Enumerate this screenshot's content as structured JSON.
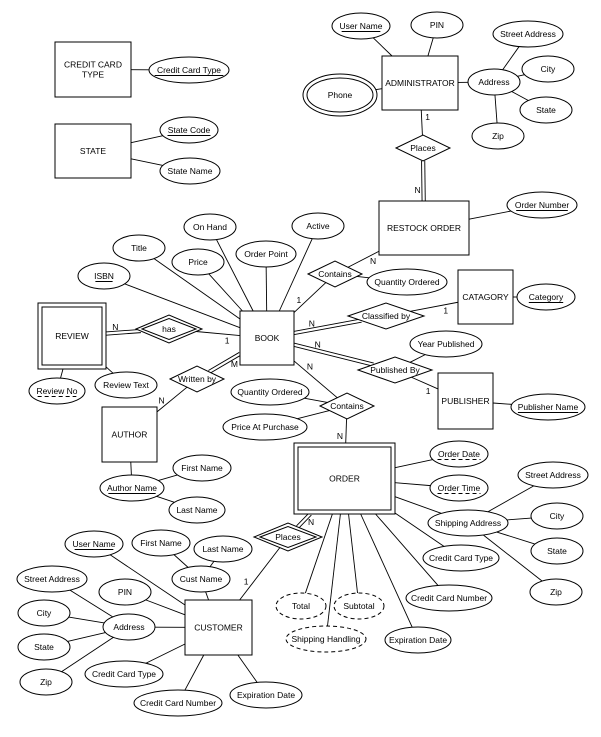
{
  "diagram": {
    "type": "entity-relationship",
    "entities": [
      {
        "id": "credit_card_type",
        "label": [
          "CREDIT CARD",
          "TYPE"
        ],
        "weak": false
      },
      {
        "id": "state",
        "label": [
          "STATE"
        ],
        "weak": false
      },
      {
        "id": "administrator",
        "label": [
          "ADMINISTRATOR"
        ],
        "weak": false
      },
      {
        "id": "restock_order",
        "label": [
          "RESTOCK ORDER"
        ],
        "weak": false
      },
      {
        "id": "catagory",
        "label": [
          "CATAGORY"
        ],
        "weak": false
      },
      {
        "id": "review",
        "label": [
          "REVIEW"
        ],
        "weak": true
      },
      {
        "id": "book",
        "label": [
          "BOOK"
        ],
        "weak": false
      },
      {
        "id": "publisher",
        "label": [
          "PUBLISHER"
        ],
        "weak": false
      },
      {
        "id": "author",
        "label": [
          "AUTHOR"
        ],
        "weak": false
      },
      {
        "id": "order",
        "label": [
          "ORDER"
        ],
        "weak": true
      },
      {
        "id": "customer",
        "label": [
          "CUSTOMER"
        ],
        "weak": false
      }
    ],
    "relationships": [
      {
        "id": "places_admin",
        "label": "Places",
        "identifying": false
      },
      {
        "id": "contains_restock",
        "label": "Contains",
        "identifying": false
      },
      {
        "id": "classified_by",
        "label": "Classified by",
        "identifying": false
      },
      {
        "id": "has",
        "label": "has",
        "identifying": true
      },
      {
        "id": "published_by",
        "label": "Published By",
        "identifying": false
      },
      {
        "id": "written_by",
        "label": "Written by",
        "identifying": false
      },
      {
        "id": "contains_order",
        "label": "Contains",
        "identifying": false
      },
      {
        "id": "places_customer",
        "label": "Places",
        "identifying": true
      }
    ],
    "attributes": [
      {
        "id": "cct_type",
        "label": "Credit Card Type",
        "key": "primary"
      },
      {
        "id": "st_code",
        "label": "State Code",
        "key": "primary"
      },
      {
        "id": "st_name",
        "label": "State Name",
        "key": "none"
      },
      {
        "id": "ad_user",
        "label": "User Name",
        "key": "primary"
      },
      {
        "id": "ad_pin",
        "label": "PIN",
        "key": "none"
      },
      {
        "id": "ad_phone",
        "label": "Phone",
        "key": "multivalued"
      },
      {
        "id": "ad_addr",
        "label": "Address",
        "key": "none"
      },
      {
        "id": "ad_street",
        "label": "Street Address",
        "key": "none"
      },
      {
        "id": "ad_city",
        "label": "City",
        "key": "none"
      },
      {
        "id": "ad_state",
        "label": "State",
        "key": "none"
      },
      {
        "id": "ad_zip",
        "label": "Zip",
        "key": "none"
      },
      {
        "id": "ro_num",
        "label": "Order Number",
        "key": "primary"
      },
      {
        "id": "rc_qty",
        "label": "Quantity Ordered",
        "key": "none"
      },
      {
        "id": "cat_cat",
        "label": "Category",
        "key": "primary"
      },
      {
        "id": "bk_onhand",
        "label": "On Hand",
        "key": "none"
      },
      {
        "id": "bk_active",
        "label": "Active",
        "key": "none"
      },
      {
        "id": "bk_title",
        "label": "Title",
        "key": "none"
      },
      {
        "id": "bk_price",
        "label": "Price",
        "key": "none"
      },
      {
        "id": "bk_orderpt",
        "label": "Order Point",
        "key": "none"
      },
      {
        "id": "bk_isbn",
        "label": "ISBN",
        "key": "primary"
      },
      {
        "id": "pb_year",
        "label": "Year Published",
        "key": "none"
      },
      {
        "id": "pub_name",
        "label": "Publisher Name",
        "key": "primary"
      },
      {
        "id": "rv_no",
        "label": "Review No",
        "key": "partial"
      },
      {
        "id": "rv_text",
        "label": "Review Text",
        "key": "none"
      },
      {
        "id": "co_qty",
        "label": "Quantity Ordered",
        "key": "none"
      },
      {
        "id": "co_price",
        "label": "Price At Purchase",
        "key": "none"
      },
      {
        "id": "au_name",
        "label": "Author Name",
        "key": "primary"
      },
      {
        "id": "au_first",
        "label": "First Name",
        "key": "none"
      },
      {
        "id": "au_last",
        "label": "Last Name",
        "key": "none"
      },
      {
        "id": "or_date",
        "label": "Order Date",
        "key": "partial"
      },
      {
        "id": "or_time",
        "label": "Order Time",
        "key": "partial"
      },
      {
        "id": "or_ship",
        "label": "Shipping Address",
        "key": "none"
      },
      {
        "id": "or_street",
        "label": "Street Address",
        "key": "none"
      },
      {
        "id": "or_city",
        "label": "City",
        "key": "none"
      },
      {
        "id": "or_state",
        "label": "State",
        "key": "none"
      },
      {
        "id": "or_zip",
        "label": "Zip",
        "key": "none"
      },
      {
        "id": "or_cctype",
        "label": "Credit Card Type",
        "key": "none"
      },
      {
        "id": "or_ccnum",
        "label": "Credit Card Number",
        "key": "none"
      },
      {
        "id": "or_exp",
        "label": "Expiration Date",
        "key": "none"
      },
      {
        "id": "or_total",
        "label": "Total",
        "key": "derived"
      },
      {
        "id": "or_subtotal",
        "label": "Subtotal",
        "key": "derived"
      },
      {
        "id": "or_shiphand",
        "label": "Shipping Handling",
        "key": "derived"
      },
      {
        "id": "cu_user",
        "label": "User Name",
        "key": "primary"
      },
      {
        "id": "cu_first",
        "label": "First Name",
        "key": "none"
      },
      {
        "id": "cu_last",
        "label": "Last Name",
        "key": "none"
      },
      {
        "id": "cu_name",
        "label": "Cust Name",
        "key": "none"
      },
      {
        "id": "cu_pin",
        "label": "PIN",
        "key": "none"
      },
      {
        "id": "cu_addr",
        "label": "Address",
        "key": "none"
      },
      {
        "id": "cu_street",
        "label": "Street Address",
        "key": "none"
      },
      {
        "id": "cu_city",
        "label": "City",
        "key": "none"
      },
      {
        "id": "cu_state",
        "label": "State",
        "key": "none"
      },
      {
        "id": "cu_zip",
        "label": "Zip",
        "key": "none"
      },
      {
        "id": "cu_cctype",
        "label": "Credit Card Type",
        "key": "none"
      },
      {
        "id": "cu_ccnum",
        "label": "Credit Card Number",
        "key": "none"
      },
      {
        "id": "cu_exp",
        "label": "Expiration Date",
        "key": "none"
      }
    ],
    "links": [
      {
        "from": "credit_card_type",
        "to": "cct_type"
      },
      {
        "from": "state",
        "to": "st_code"
      },
      {
        "from": "state",
        "to": "st_name"
      },
      {
        "from": "administrator",
        "to": "ad_user"
      },
      {
        "from": "administrator",
        "to": "ad_pin"
      },
      {
        "from": "administrator",
        "to": "ad_phone"
      },
      {
        "from": "administrator",
        "to": "ad_addr"
      },
      {
        "from": "ad_addr",
        "to": "ad_street"
      },
      {
        "from": "ad_addr",
        "to": "ad_city"
      },
      {
        "from": "ad_addr",
        "to": "ad_state"
      },
      {
        "from": "ad_addr",
        "to": "ad_zip"
      },
      {
        "from": "administrator",
        "to": "places_admin",
        "card": "1",
        "double": false
      },
      {
        "from": "places_admin",
        "to": "restock_order",
        "card": "N",
        "double": true
      },
      {
        "from": "restock_order",
        "to": "ro_num"
      },
      {
        "from": "contains_restock",
        "to": "restock_order",
        "card": "N",
        "double": false
      },
      {
        "from": "book",
        "to": "contains_restock",
        "card": "1",
        "double": false
      },
      {
        "from": "contains_restock",
        "to": "rc_qty"
      },
      {
        "from": "catagory",
        "to": "cat_cat"
      },
      {
        "from": "book",
        "to": "classified_by",
        "card": "N",
        "double": true
      },
      {
        "from": "classified_by",
        "to": "catagory",
        "card": "1",
        "double": false
      },
      {
        "from": "book",
        "to": "bk_onhand"
      },
      {
        "from": "book",
        "to": "bk_active"
      },
      {
        "from": "book",
        "to": "bk_title"
      },
      {
        "from": "book",
        "to": "bk_price"
      },
      {
        "from": "book",
        "to": "bk_orderpt"
      },
      {
        "from": "book",
        "to": "bk_isbn"
      },
      {
        "from": "review",
        "to": "has",
        "card": "N",
        "double": true
      },
      {
        "from": "has",
        "to": "book",
        "card": "1",
        "double": false
      },
      {
        "from": "review",
        "to": "rv_no"
      },
      {
        "from": "review",
        "to": "rv_text"
      },
      {
        "from": "book",
        "to": "published_by",
        "card": "N",
        "double": true
      },
      {
        "from": "published_by",
        "to": "publisher",
        "card": "1",
        "double": false
      },
      {
        "from": "published_by",
        "to": "pb_year"
      },
      {
        "from": "publisher",
        "to": "pub_name"
      },
      {
        "from": "book",
        "to": "written_by",
        "card": "M",
        "double": true
      },
      {
        "from": "written_by",
        "to": "author",
        "card": "N",
        "double": false
      },
      {
        "from": "author",
        "to": "au_name"
      },
      {
        "from": "au_name",
        "to": "au_first"
      },
      {
        "from": "au_name",
        "to": "au_last"
      },
      {
        "from": "book",
        "to": "contains_order",
        "card": "N",
        "double": false
      },
      {
        "from": "contains_order",
        "to": "order",
        "card": "N",
        "double": false
      },
      {
        "from": "contains_order",
        "to": "co_qty"
      },
      {
        "from": "contains_order",
        "to": "co_price"
      },
      {
        "from": "order",
        "to": "or_date"
      },
      {
        "from": "order",
        "to": "or_time"
      },
      {
        "from": "order",
        "to": "or_ship"
      },
      {
        "from": "or_ship",
        "to": "or_street"
      },
      {
        "from": "or_ship",
        "to": "or_city"
      },
      {
        "from": "or_ship",
        "to": "or_state"
      },
      {
        "from": "or_ship",
        "to": "or_zip"
      },
      {
        "from": "order",
        "to": "or_cctype"
      },
      {
        "from": "order",
        "to": "or_ccnum"
      },
      {
        "from": "order",
        "to": "or_exp"
      },
      {
        "from": "order",
        "to": "or_total"
      },
      {
        "from": "order",
        "to": "or_subtotal"
      },
      {
        "from": "order",
        "to": "or_shiphand"
      },
      {
        "from": "order",
        "to": "places_customer",
        "card": "N",
        "double": true
      },
      {
        "from": "places_customer",
        "to": "customer",
        "card": "1",
        "double": false
      },
      {
        "from": "customer",
        "to": "cu_user"
      },
      {
        "from": "customer",
        "to": "cu_name"
      },
      {
        "from": "cu_name",
        "to": "cu_first"
      },
      {
        "from": "cu_name",
        "to": "cu_last"
      },
      {
        "from": "customer",
        "to": "cu_pin"
      },
      {
        "from": "customer",
        "to": "cu_addr"
      },
      {
        "from": "cu_addr",
        "to": "cu_street"
      },
      {
        "from": "cu_addr",
        "to": "cu_city"
      },
      {
        "from": "cu_addr",
        "to": "cu_state"
      },
      {
        "from": "cu_addr",
        "to": "cu_zip"
      },
      {
        "from": "customer",
        "to": "cu_cctype"
      },
      {
        "from": "customer",
        "to": "cu_ccnum"
      },
      {
        "from": "customer",
        "to": "cu_exp"
      }
    ]
  }
}
